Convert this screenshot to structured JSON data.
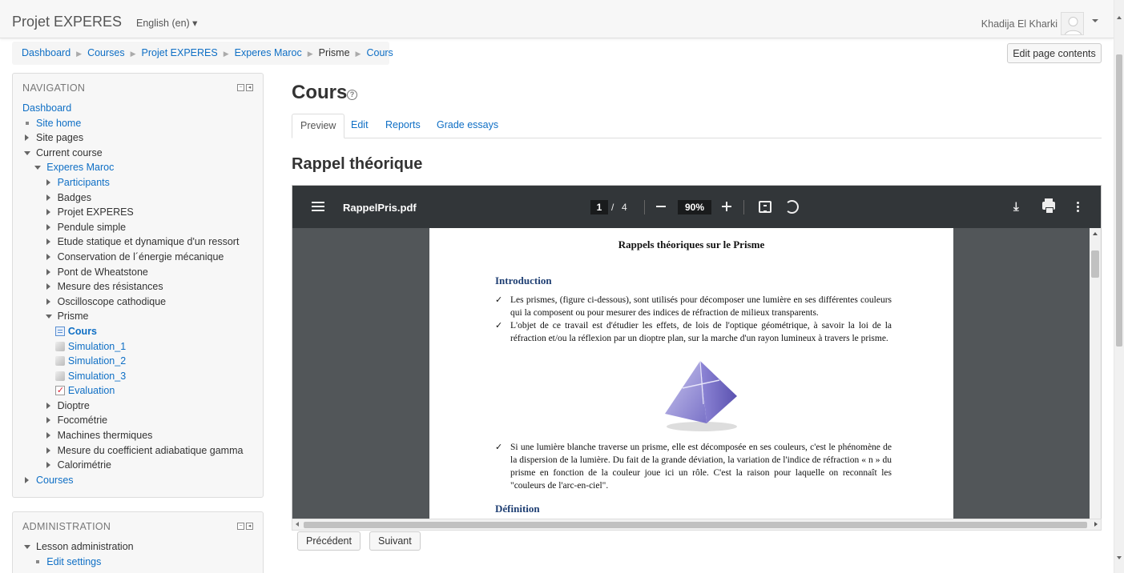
{
  "header": {
    "site_name": "Projet EXPERES",
    "language": "English (en) ▾",
    "user_name": "Khadija El Kharki"
  },
  "breadcrumb": [
    "Dashboard",
    "Courses",
    "Projet EXPERES",
    "Experes Maroc",
    "Prisme",
    "Cours"
  ],
  "edit_page_button": "Edit page contents",
  "navigation": {
    "title": "NAVIGATION",
    "items": [
      {
        "label": "Dashboard",
        "level": 0,
        "marker": "none",
        "link": true
      },
      {
        "label": "Site home",
        "level": 0,
        "marker": "square",
        "link": true
      },
      {
        "label": "Site pages",
        "level": 0,
        "marker": "closed",
        "link": false
      },
      {
        "label": "Current course",
        "level": 0,
        "marker": "open",
        "link": false
      },
      {
        "label": "Experes Maroc",
        "level": 1,
        "marker": "open",
        "link": true
      },
      {
        "label": "Participants",
        "level": 2,
        "marker": "closed",
        "link": true
      },
      {
        "label": "Badges",
        "level": 2,
        "marker": "closed",
        "link": false
      },
      {
        "label": "Projet EXPERES",
        "level": 2,
        "marker": "closed",
        "link": false
      },
      {
        "label": "Pendule simple",
        "level": 2,
        "marker": "closed",
        "link": false
      },
      {
        "label": "Etude statique et dynamique d'un ressort",
        "level": 2,
        "marker": "closed",
        "link": false
      },
      {
        "label": "Conservation de l´énergie mécanique",
        "level": 2,
        "marker": "closed",
        "link": false
      },
      {
        "label": "Pont de Wheatstone",
        "level": 2,
        "marker": "closed",
        "link": false
      },
      {
        "label": "Mesure des résistances",
        "level": 2,
        "marker": "closed",
        "link": false
      },
      {
        "label": "Oscilloscope cathodique",
        "level": 2,
        "marker": "closed",
        "link": false
      },
      {
        "label": "Prisme",
        "level": 2,
        "marker": "open",
        "link": false
      },
      {
        "label": "Cours",
        "level": 3,
        "marker": "page-icon",
        "link": true,
        "bold": true
      },
      {
        "label": "Simulation_1",
        "level": 3,
        "marker": "sim-icon",
        "link": true
      },
      {
        "label": "Simulation_2",
        "level": 3,
        "marker": "sim-icon",
        "link": true
      },
      {
        "label": "Simulation_3",
        "level": 3,
        "marker": "sim-icon",
        "link": true
      },
      {
        "label": "Evaluation",
        "level": 3,
        "marker": "eval-icon",
        "link": true
      },
      {
        "label": "Dioptre",
        "level": 2,
        "marker": "closed",
        "link": false
      },
      {
        "label": "Focométrie",
        "level": 2,
        "marker": "closed",
        "link": false
      },
      {
        "label": "Machines thermiques",
        "level": 2,
        "marker": "closed",
        "link": false
      },
      {
        "label": "Mesure du coefficient adiabatique gamma",
        "level": 2,
        "marker": "closed",
        "link": false
      },
      {
        "label": "Calorimétrie",
        "level": 2,
        "marker": "closed",
        "link": false
      },
      {
        "label": "Courses",
        "level": 0,
        "marker": "closed",
        "link": true
      }
    ]
  },
  "administration": {
    "title": "ADMINISTRATION",
    "items": [
      {
        "label": "Lesson administration",
        "level": 0,
        "marker": "open",
        "link": false
      },
      {
        "label": "Edit settings",
        "level": 1,
        "marker": "square",
        "link": true
      }
    ]
  },
  "page_title": "Cours",
  "tabs": [
    "Preview",
    "Edit",
    "Reports",
    "Grade essays"
  ],
  "active_tab": "Preview",
  "section_title": "Rappel théorique",
  "pdf": {
    "file_name": "RappelPris.pdf",
    "current_page": "1",
    "page_separator": "/",
    "total_pages": "4",
    "zoom": "90%",
    "download_glyph": "⤓",
    "document": {
      "title": "Rappels théoriques sur le Prisme",
      "heading_intro": "Introduction",
      "bullets": [
        "Les prismes, (figure ci-dessous), sont utilisés pour décomposer une lumière en ses différentes couleurs qui la composent ou pour mesurer des indices de réfraction de milieux transparents.",
        "L'objet de ce travail est d'étudier les effets, de lois de l'optique géométrique, à savoir la loi de la réfraction et/ou la réflexion par un dioptre plan, sur la marche d'un rayon lumineux à travers le prisme.",
        "Si une lumière blanche traverse un prisme, elle est décomposée en ses couleurs, c'est le phénomène de la dispersion de la lumière. Du fait de la grande déviation, la variation de l'indice de réfraction « n » du prisme en fonction de la couleur joue ici un rôle. C'est la raison pour laquelle on reconnaît les \"couleurs de l'arc-en-ciel\"."
      ],
      "heading_definition": "Définition",
      "check_glyph": "✓"
    }
  },
  "pager": {
    "previous": "Précédent",
    "next": "Suivant"
  }
}
